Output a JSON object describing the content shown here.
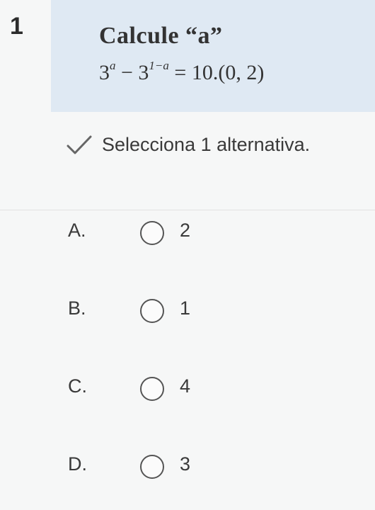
{
  "question": {
    "number": "1",
    "prompt": "Calcule “a”",
    "equation": {
      "base1": "3",
      "exp1": "a",
      "minus": " − ",
      "base2": "3",
      "exp2": "1−a",
      "rhs": " = 10.(0, 2)"
    }
  },
  "instruction": "Selecciona 1 alternativa.",
  "icons": {
    "instruction": "check-icon",
    "option": "radio-button-icon"
  },
  "options": [
    {
      "letter": "A.",
      "value": "2"
    },
    {
      "letter": "B.",
      "value": "1"
    },
    {
      "letter": "C.",
      "value": "4"
    },
    {
      "letter": "D.",
      "value": "3"
    }
  ],
  "colors": {
    "question_background": "#dfe9f3",
    "page_background": "#f6f7f7"
  }
}
